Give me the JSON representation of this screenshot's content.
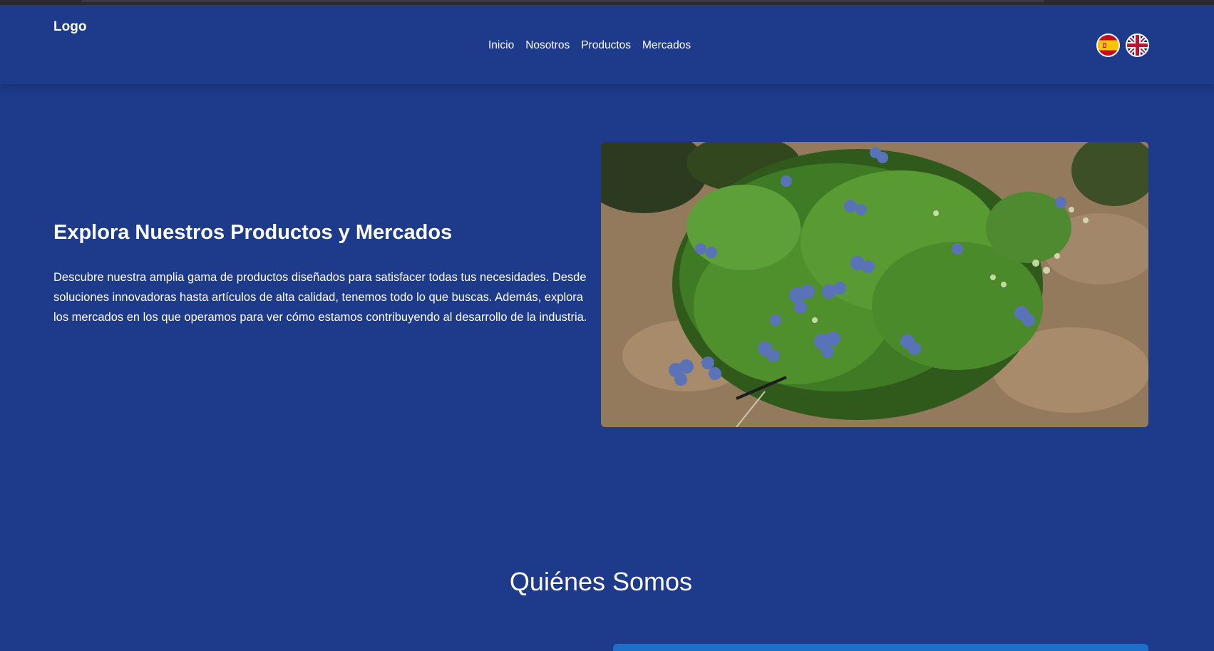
{
  "header": {
    "logo": "Logo",
    "nav": [
      "Inicio",
      "Nosotros",
      "Productos",
      "Mercados"
    ],
    "flags": [
      "spain-flag-icon",
      "uk-flag-icon"
    ]
  },
  "hero": {
    "title": "Explora Nuestros Productos y Mercados",
    "text": "Descubre nuestra amplia gama de productos diseñados para satisfacer todas tus necesidades. Desde soluciones innovadoras hasta artículos de alta calidad, tenemos todo lo que buscas. Además, explora los mercados en los que operamos para ver cómo estamos contribuyendo al desarrollo de la industria."
  },
  "about": {
    "title": "Quiénes Somos"
  },
  "colors": {
    "background": "#1e3a8a",
    "accent": "#1d6fc9"
  }
}
